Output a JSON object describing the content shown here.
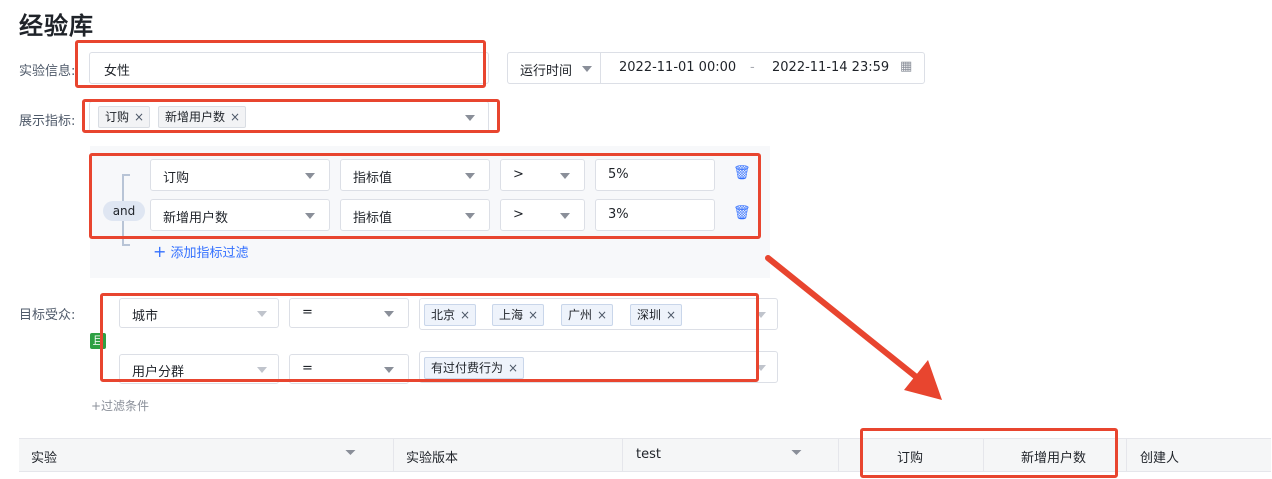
{
  "page": {
    "title": "经验库"
  },
  "experiment_info": {
    "label": "实验信息:",
    "value": "女性",
    "time_select": "运行时间",
    "start": "2022-11-01 00:00",
    "sep": "-",
    "end": "2022-11-14 23:59"
  },
  "metrics": {
    "label": "展示指标:",
    "tags": [
      "订购",
      "新增用户数"
    ]
  },
  "metric_filter": {
    "logic": "and",
    "rows": [
      {
        "metric": "订购",
        "field": "指标值",
        "operator": ">",
        "value": "5%"
      },
      {
        "metric": "新增用户数",
        "field": "指标值",
        "operator": ">",
        "value": "3%"
      }
    ],
    "add_label": "添加指标过滤"
  },
  "audience": {
    "label": "目标受众:",
    "logic_badge": "且",
    "rows": [
      {
        "field": "城市",
        "operator": "=",
        "tags": [
          "北京",
          "上海",
          "广州",
          "深圳"
        ]
      },
      {
        "field": "用户分群",
        "operator": "=",
        "tags": [
          "有过付费行为"
        ]
      }
    ],
    "add_label": "+过滤条件"
  },
  "table": {
    "columns": [
      "实验",
      "实验版本",
      "test",
      "订购",
      "新增用户数",
      "创建人"
    ]
  },
  "icons": {
    "remove": "×",
    "add": "+",
    "trash": "🗑",
    "filter": "⏷",
    "calendar": "▦"
  }
}
